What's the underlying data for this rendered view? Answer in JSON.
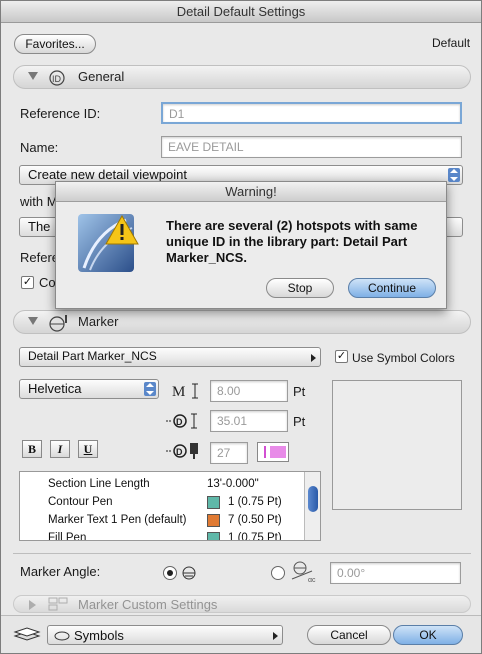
{
  "window": {
    "title": "Detail Default Settings"
  },
  "header": {
    "favorites_label": "Favorites...",
    "default_label": "Default"
  },
  "general": {
    "section_label": "General",
    "reference_id_label": "Reference ID:",
    "reference_id_value": "D1",
    "name_label": "Name:",
    "name_value": "EAVE DETAIL",
    "create_option": "Create new detail viewpoint",
    "with_label": "with M",
    "the_label": "The",
    "refer_label": "Refere",
    "co_label": "Co"
  },
  "dialog": {
    "title": "Warning!",
    "message": "There are several (2) hotspots with same unique ID in the library part: Detail Part Marker_NCS.",
    "stop_label": "Stop",
    "continue_label": "Continue"
  },
  "marker": {
    "section_label": "Marker",
    "part_name": "Detail Part Marker_NCS",
    "use_symbol_colors_label": "Use Symbol Colors",
    "font_name": "Helvetica",
    "size1_value": "8.00",
    "size1_unit": "Pt",
    "size2_value": "35.01",
    "size2_unit": "Pt",
    "pen_value": "27",
    "bold_label": "B",
    "italic_label": "I",
    "underline_label": "U",
    "list_rows": [
      {
        "label": "Section Line Length",
        "value": "13'-0.000\"",
        "color": ""
      },
      {
        "label": "Contour Pen",
        "value": "1 (0.75 Pt)",
        "color": "#5fb8a9"
      },
      {
        "label": "Marker Text 1 Pen (default)",
        "value": "7 (0.50 Pt)",
        "color": "#e07a33"
      },
      {
        "label": "Fill Pen",
        "value": "1 (0.75 Pt)",
        "color": "#5fb8a9"
      }
    ],
    "angle_label": "Marker Angle:",
    "angle_value": "0.00°",
    "pen_swatch_color": "#e88be8"
  },
  "custom": {
    "section_label": "Marker Custom Settings"
  },
  "footer": {
    "layer_label": "Symbols",
    "cancel_label": "Cancel",
    "ok_label": "OK"
  }
}
